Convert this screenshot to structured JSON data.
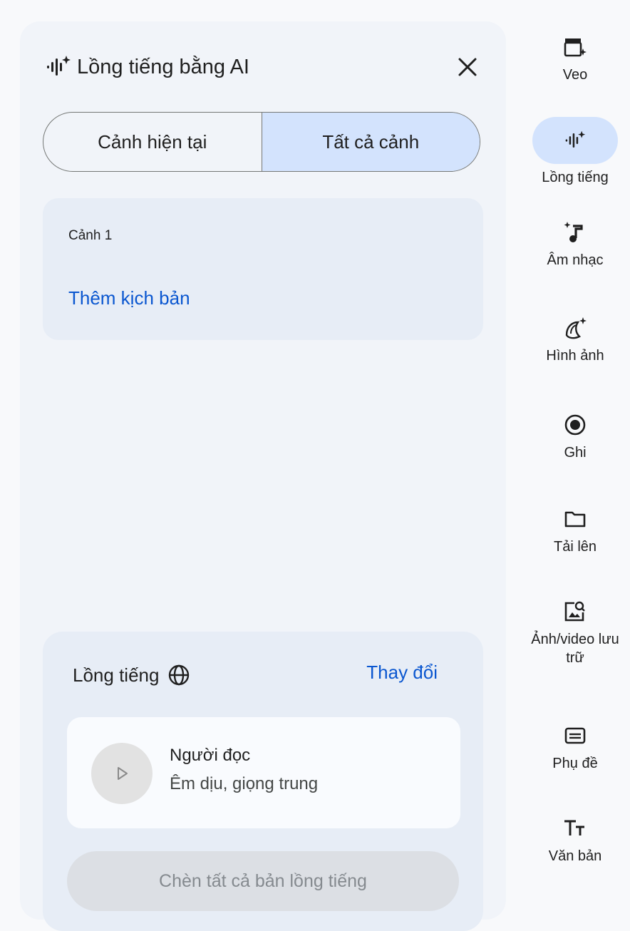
{
  "panel": {
    "title": "Lồng tiếng bằng AI",
    "tabs": [
      "Cảnh hiện tại",
      "Tất cả cảnh"
    ],
    "active_tab": 1
  },
  "scene": {
    "label": "Cảnh 1",
    "add_script": "Thêm kịch bản"
  },
  "voice": {
    "title": "Lồng tiếng",
    "change": "Thay đổi",
    "name": "Người đọc",
    "description": "Êm dịu, giọng trung",
    "insert_all": "Chèn tất cả bản lồng tiếng"
  },
  "rail": {
    "active_index": 1,
    "items": [
      {
        "label": "Veo",
        "icon": "clapperboard-sparkle-icon"
      },
      {
        "label": "Lồng tiếng",
        "icon": "waveform-sparkle-icon"
      },
      {
        "label": "Âm nhạc",
        "icon": "music-note-sparkle-icon"
      },
      {
        "label": "Hình ảnh",
        "icon": "banana-sparkle-icon"
      },
      {
        "label": "Ghi",
        "icon": "record-icon"
      },
      {
        "label": "Tải lên",
        "icon": "folder-icon"
      },
      {
        "label": "Ảnh/video lưu trữ",
        "icon": "stock-image-icon"
      },
      {
        "label": "Phụ đề",
        "icon": "subtitles-icon"
      },
      {
        "label": "Văn bản",
        "icon": "text-icon"
      }
    ]
  },
  "colors": {
    "accent": "#0b57d0",
    "active_bg": "#d3e3fd",
    "panel_bg": "#f1f4f9",
    "card_bg": "#e7edf6"
  }
}
